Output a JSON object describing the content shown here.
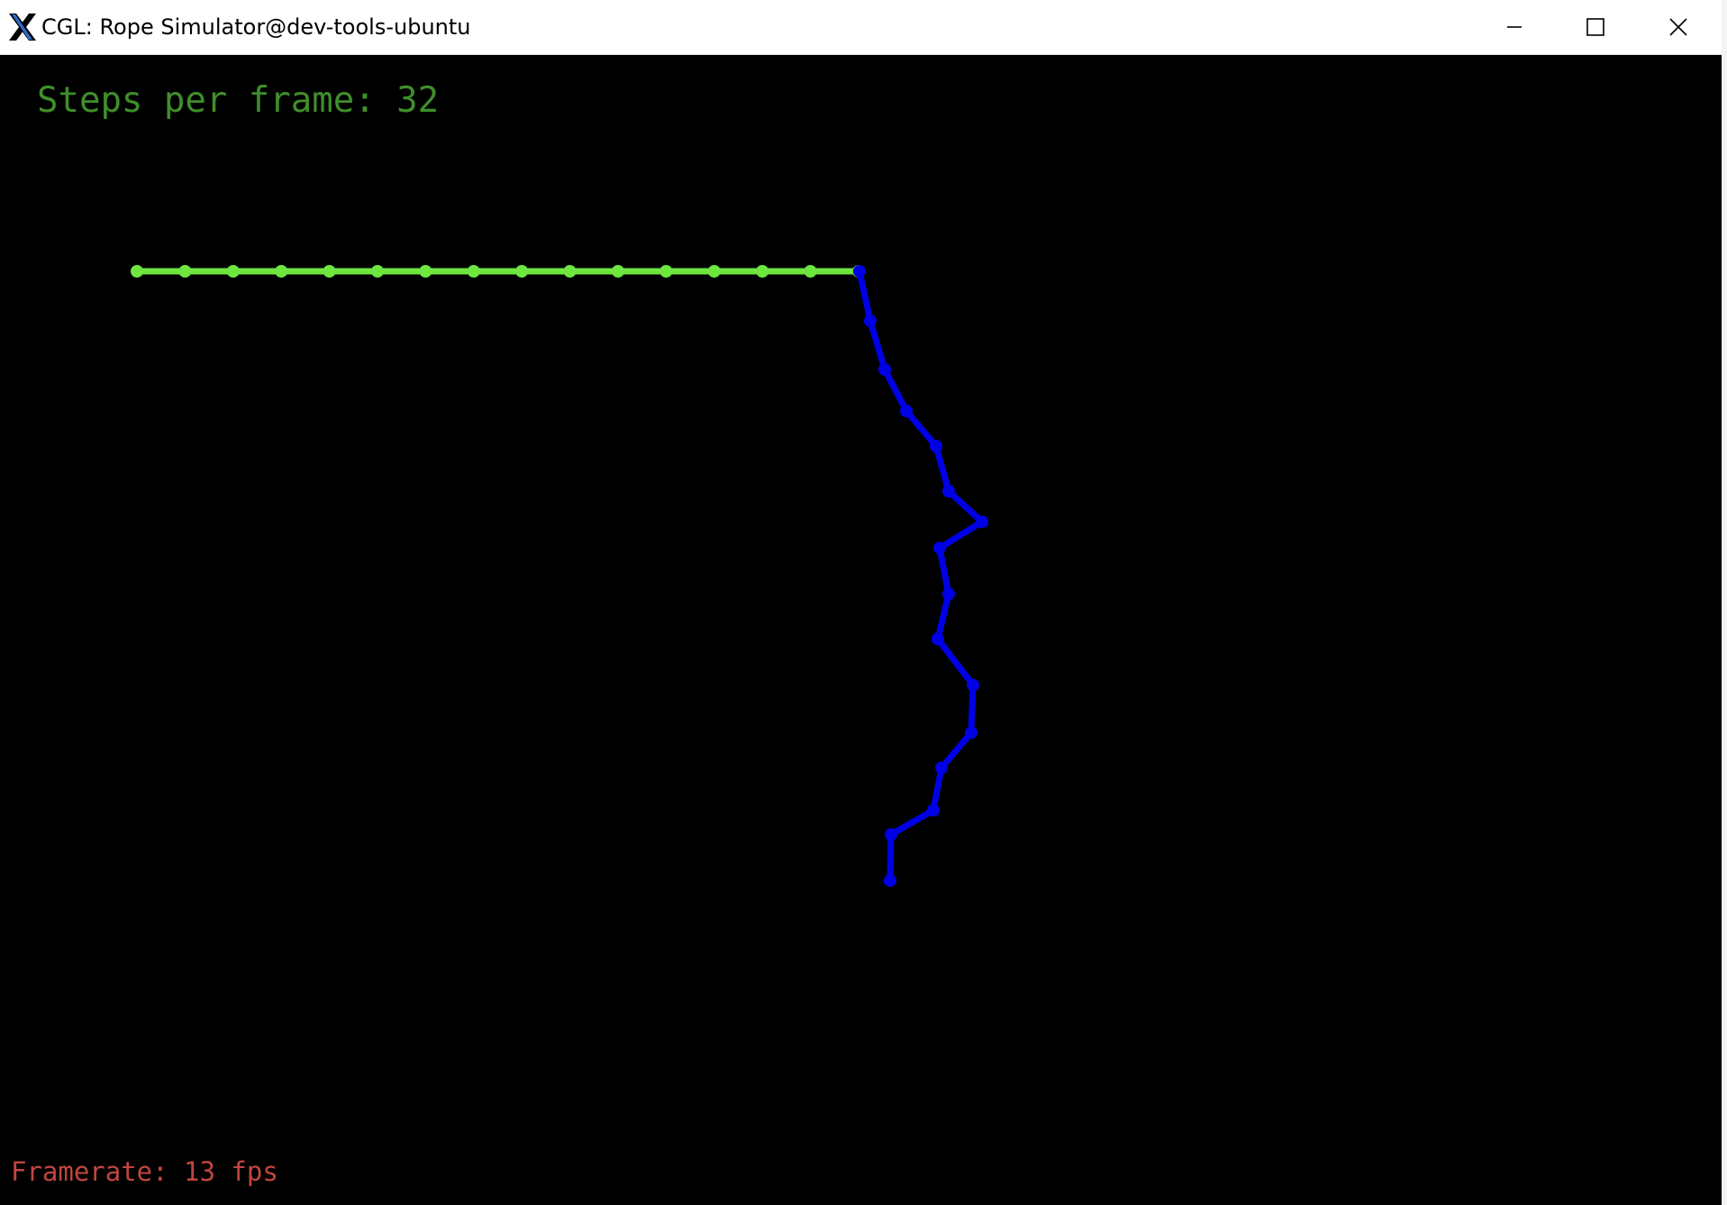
{
  "window": {
    "title": "CGL: Rope Simulator@dev-tools-ubuntu",
    "app_icon": "x11-logo-icon",
    "controls": {
      "minimize_icon": "minimize-icon",
      "maximize_icon": "maximize-icon",
      "close_icon": "close-icon"
    }
  },
  "overlay": {
    "steps_text": "Steps per frame: 32",
    "framerate_text": "Framerate: 13 fps"
  },
  "colors": {
    "background": "#000000",
    "steps_text": "#3f8f2a",
    "framerate_text": "#c0463f",
    "rope_green": "#6ee63f",
    "rope_blue": "#0000e6"
  },
  "ropes": [
    {
      "name": "green",
      "color": "#6ee63f",
      "node_count": 16
    },
    {
      "name": "blue",
      "color": "#0000e6",
      "node_count": 16
    }
  ]
}
